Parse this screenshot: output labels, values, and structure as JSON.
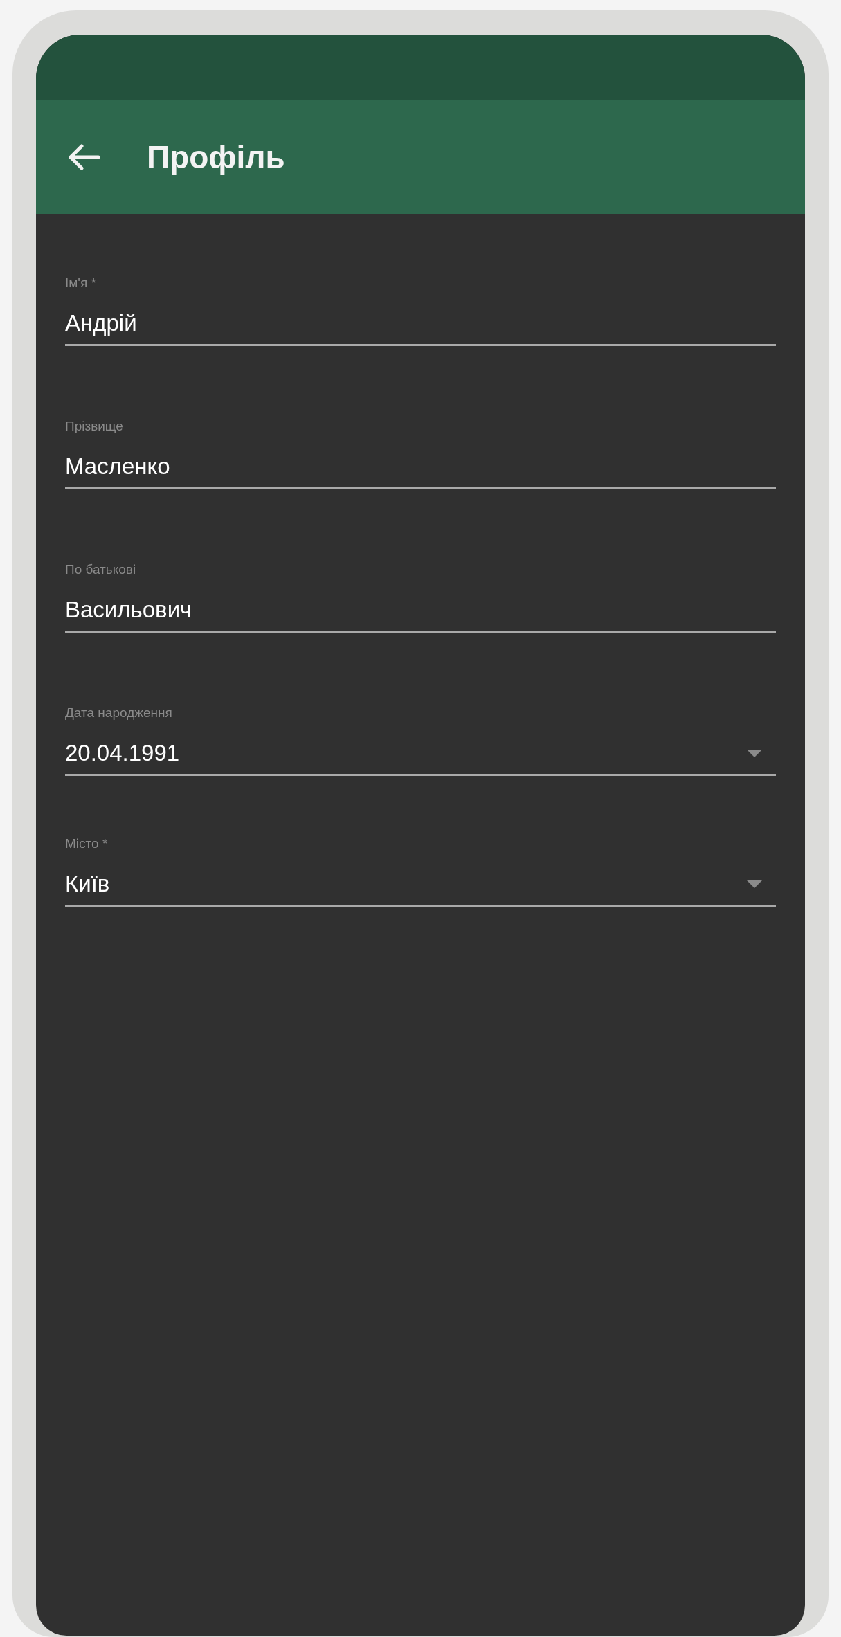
{
  "app_bar": {
    "title": "Профіль"
  },
  "fields": [
    {
      "kind": "text",
      "label": "Ім'я *",
      "value": "Андрій"
    },
    {
      "kind": "text",
      "label": "Прізвище",
      "value": "Масленко"
    },
    {
      "kind": "text",
      "label": "По батькові",
      "value": "Васильович"
    },
    {
      "kind": "dropdown",
      "label": "Дата народження",
      "value": "20.04.1991"
    },
    {
      "kind": "dropdown",
      "label": "Місто *",
      "value": "Київ"
    }
  ]
}
